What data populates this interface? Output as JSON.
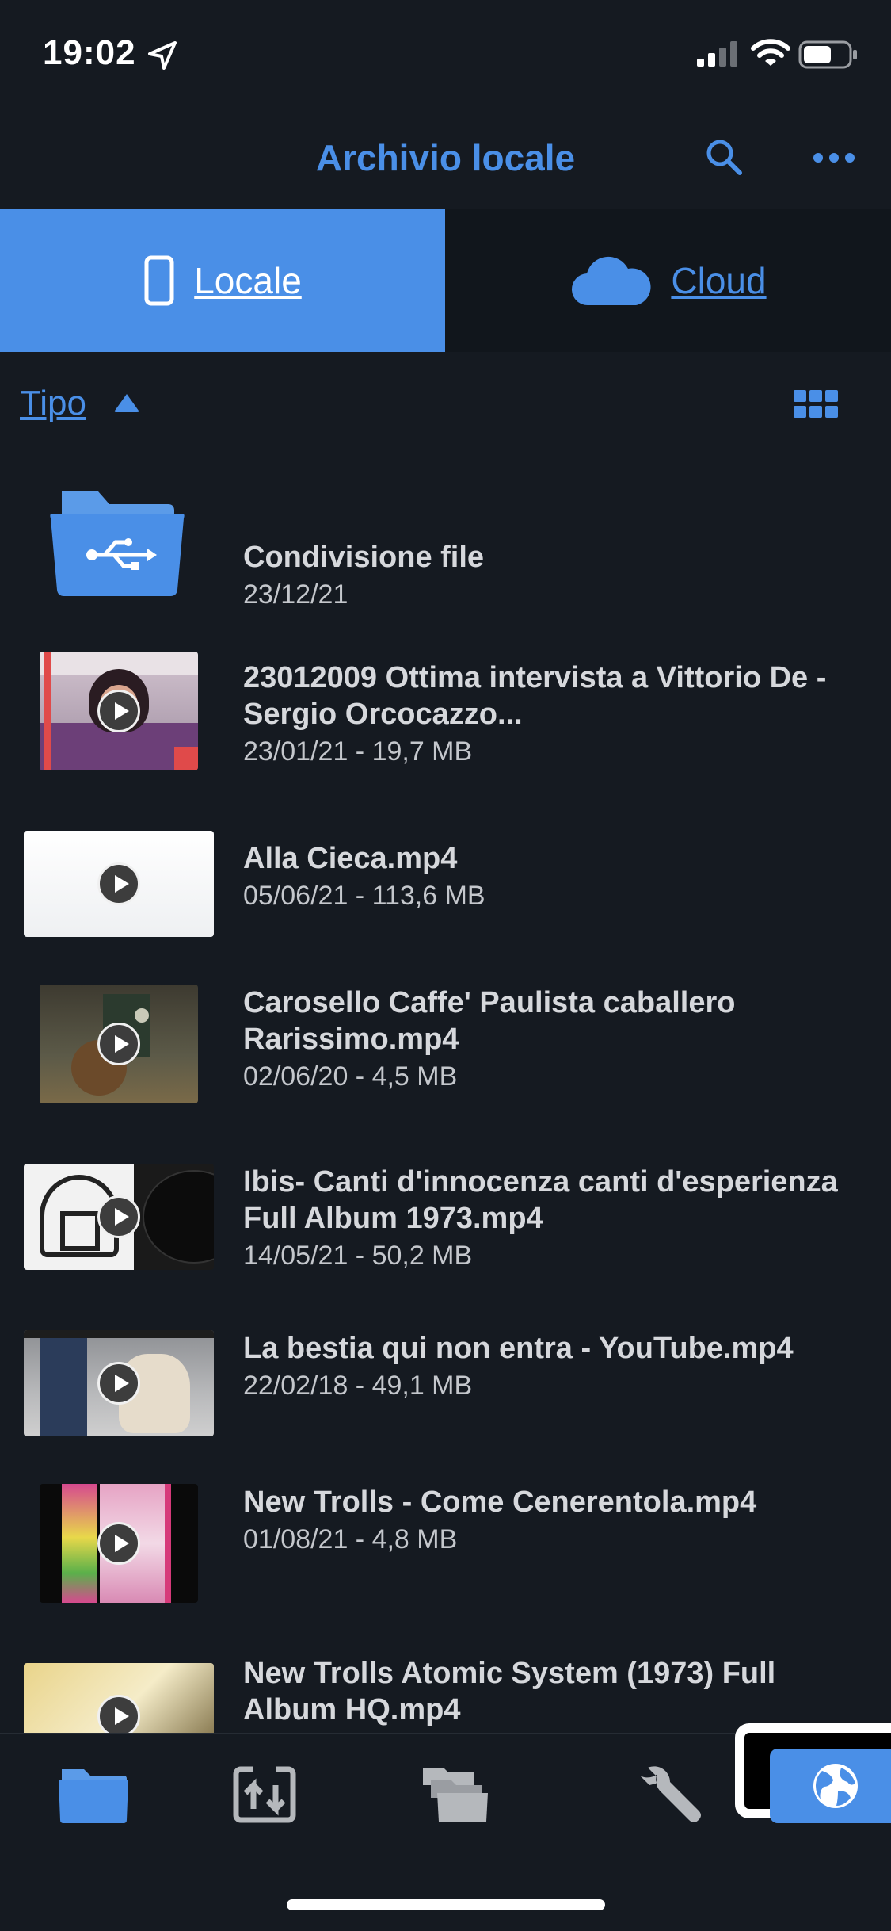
{
  "status_bar": {
    "time": "19:02"
  },
  "header": {
    "title": "Archivio locale"
  },
  "tabs": [
    {
      "label": "Locale",
      "icon": "phone-icon",
      "selected": true
    },
    {
      "label": "Cloud",
      "icon": "cloud-icon",
      "selected": false
    }
  ],
  "sort": {
    "label": "Tipo",
    "direction": "ascending"
  },
  "files": [
    {
      "name": "Condivisione file",
      "meta": "23/12/21",
      "type": "folder"
    },
    {
      "name": "23012009 Ottima intervista a Vittorio De - Sergio Orcocazzo...",
      "meta": "23/01/21 - 19,7 MB",
      "type": "video"
    },
    {
      "name": "Alla Cieca.mp4",
      "meta": "05/06/21 - 113,6 MB",
      "type": "video"
    },
    {
      "name": "Carosello Caffe' Paulista caballero Rarissimo.mp4",
      "meta": "02/06/20 - 4,5 MB",
      "type": "video"
    },
    {
      "name": "Ibis-  Canti d'innocenza canti d'esperienza Full Album 1973.mp4",
      "meta": "14/05/21 - 50,2 MB",
      "type": "video"
    },
    {
      "name": "La bestia qui non entra - YouTube.mp4",
      "meta": "22/02/18 - 49,1 MB",
      "type": "video"
    },
    {
      "name": "New Trolls - Come Cenerentola.mp4",
      "meta": "01/08/21 - 4,8 MB",
      "type": "video"
    },
    {
      "name": "New Trolls Atomic System (1973) Full Album HQ.mp4",
      "meta": "",
      "type": "video"
    }
  ],
  "colors": {
    "accent": "#4a8fe7",
    "background": "#151a21",
    "tab_inactive": "#11161c"
  },
  "bottom_tabs": [
    {
      "icon": "folder-icon",
      "selected": true
    },
    {
      "icon": "transfer-icon",
      "selected": false
    },
    {
      "icon": "files-icon",
      "selected": false
    },
    {
      "icon": "wrench-icon",
      "selected": false
    },
    {
      "icon": "globe-icon",
      "selected": false
    }
  ]
}
